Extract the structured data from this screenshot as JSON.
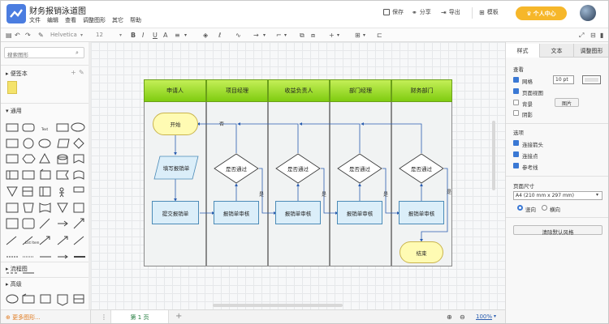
{
  "app": {
    "title": "财务报销泳道图",
    "menu": [
      "文件",
      "编辑",
      "查看",
      "调整图形",
      "其它",
      "帮助"
    ],
    "actions": {
      "save": "保存",
      "share": "分享",
      "export": "导出",
      "templates": "模板",
      "vip": "个人中心"
    }
  },
  "toolbar": {
    "font_name": "Helvetica",
    "font_size": "12",
    "zoom_percent": "100%"
  },
  "left_panel": {
    "search_placeholder": "搜索图形",
    "sections": {
      "notes": "便签本",
      "general": "通用",
      "flowchart": "流程图",
      "advanced": "高级"
    },
    "more_shapes": "更多图形..."
  },
  "right_panel": {
    "tabs": [
      "样式",
      "文本",
      "调整图形"
    ],
    "view": {
      "heading": "查看",
      "options": [
        {
          "label": "网格",
          "checked": true
        },
        {
          "label": "页面视图",
          "checked": true
        },
        {
          "label": "背景",
          "checked": false
        },
        {
          "label": "阴影",
          "checked": false
        }
      ],
      "grid_size": "10 pt",
      "image_button": "图片"
    },
    "options": {
      "heading": "选项",
      "items": [
        {
          "label": "连接箭头",
          "checked": true
        },
        {
          "label": "连接点",
          "checked": true
        },
        {
          "label": "参考线",
          "checked": true
        }
      ]
    },
    "page_size": {
      "heading": "页面尺寸",
      "selected": "A4 (210 mm x 297 mm)",
      "orientation": [
        {
          "label": "竖向",
          "selected": true
        },
        {
          "label": "横向",
          "selected": false
        }
      ]
    },
    "reset_button": "清除默认风格"
  },
  "diagram": {
    "lanes": [
      "申请人",
      "项目经理",
      "收益负责人",
      "部门经理",
      "财务部门"
    ],
    "nodes": {
      "start": "开始",
      "fill_form": "填写报销单",
      "submit": "提交报销单",
      "review_1": "报销单审核",
      "review_2": "报销单审核",
      "review_3": "报销单审核",
      "review_4": "报销单审核",
      "decision_1": "是否通过",
      "decision_2": "是否通过",
      "decision_3": "是否通过",
      "decision_4": "是否通过",
      "end": "结束"
    },
    "edge_labels": {
      "no": "否",
      "yes": "是"
    }
  },
  "bottom": {
    "page_tab": "第 1 页",
    "add_page": "+"
  }
}
